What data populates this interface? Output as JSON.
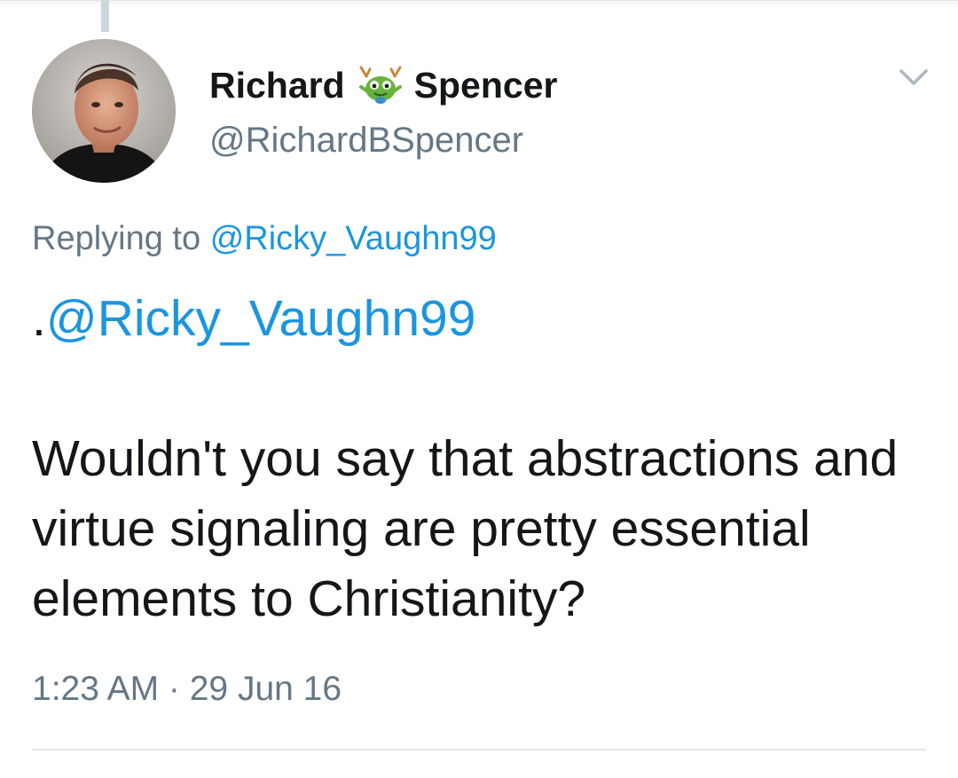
{
  "tweet": {
    "display_name_first": "Richard",
    "display_name_last": "Spencer",
    "emoji_icon": "alien-monster-emoji-icon",
    "handle": "@RichardBSpencer",
    "replying_prefix": "Replying to",
    "replying_to": "@Ricky_Vaughn99",
    "text_dot": ".",
    "text_mention": "@Ricky_Vaughn99",
    "text_body": "Wouldn't you say that abstractions and virtue signaling are pretty essential elements to Christianity?",
    "timestamp": "1:23 AM · 29 Jun 16"
  },
  "colors": {
    "link": "#1b95e0",
    "secondary_text": "#657786",
    "primary_text": "#14171a",
    "divider": "#e1e8ed"
  }
}
